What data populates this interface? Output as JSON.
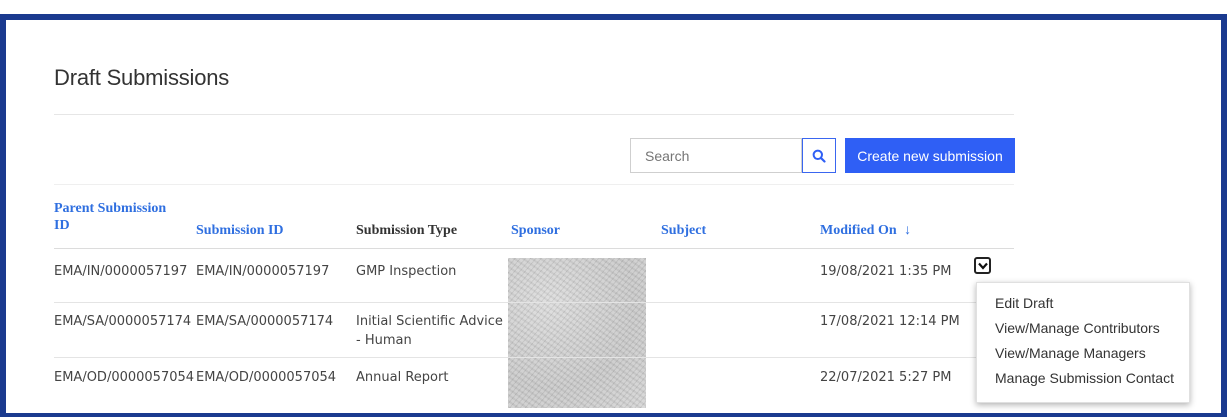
{
  "page": {
    "title": "Draft Submissions"
  },
  "toolbar": {
    "search_placeholder": "Search",
    "create_label": "Create new submission"
  },
  "table": {
    "columns": {
      "parent_id": "Parent Submission ID",
      "parent_id_line1": "Parent Submission",
      "parent_id_line2": "ID",
      "submission_id": "Submission ID",
      "submission_type": "Submission Type",
      "sponsor": "Sponsor",
      "subject": "Subject",
      "modified_on": "Modified On",
      "sort_arrow": "↓"
    },
    "rows": [
      {
        "parent_id": "EMA/IN/0000057197",
        "submission_id": "EMA/IN/0000057197",
        "type": "GMP Inspection",
        "type_line2": "",
        "sponsor": "",
        "subject": "",
        "modified_on": "19/08/2021 1:35 PM"
      },
      {
        "parent_id": "EMA/SA/0000057174",
        "submission_id": "EMA/SA/0000057174",
        "type": "Initial Scientific Advice",
        "type_line2": "- Human",
        "sponsor": "",
        "subject": "",
        "modified_on": "17/08/2021 12:14 PM"
      },
      {
        "parent_id": "EMA/OD/0000057054",
        "submission_id": "EMA/OD/0000057054",
        "type": "Annual Report",
        "type_line2": "",
        "sponsor": "",
        "subject": "",
        "modified_on": "22/07/2021 5:27 PM"
      }
    ]
  },
  "action_menu": {
    "items": [
      "Edit Draft",
      "View/Manage Contributors",
      "View/Manage Managers",
      "Manage Submission Contact"
    ]
  },
  "colors": {
    "frame": "#1a3a8f",
    "primary_button": "#2f5ff5",
    "link": "#2f6fe0"
  },
  "icons": {
    "search": "search-icon",
    "dropdown": "chevron-down-icon",
    "sort": "arrow-down-icon"
  }
}
